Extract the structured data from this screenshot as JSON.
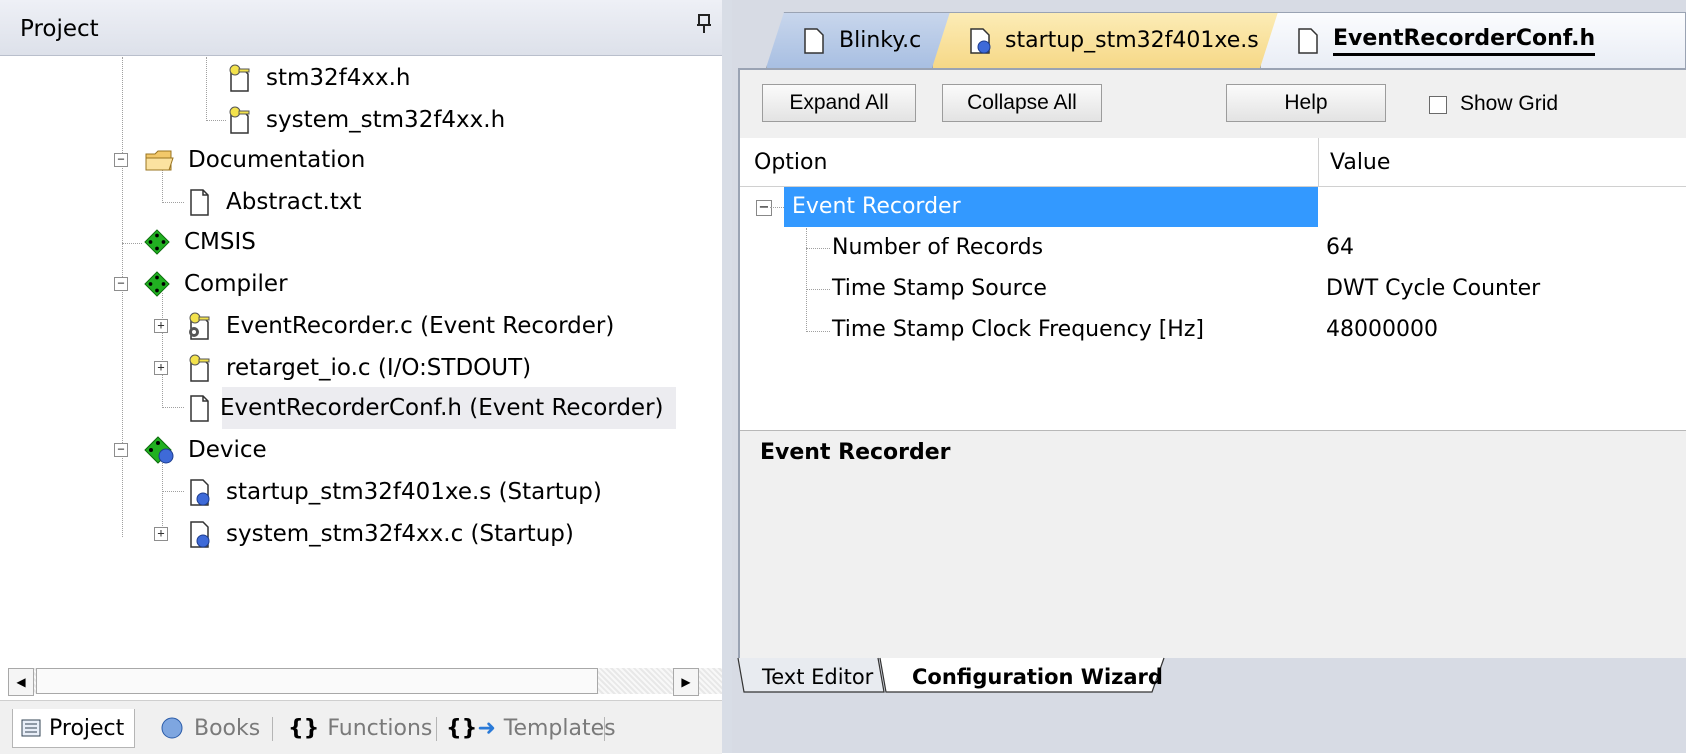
{
  "project_pane": {
    "title": "Project",
    "tree": [
      {
        "label": "stm32f4xx.h",
        "icon": "header-key-icon"
      },
      {
        "label": "system_stm32f4xx.h",
        "icon": "header-key-icon"
      },
      {
        "label": "Documentation",
        "icon": "folder-icon",
        "expanded": true
      },
      {
        "label": "Abstract.txt",
        "icon": "file-icon"
      },
      {
        "label": "CMSIS",
        "icon": "component-icon"
      },
      {
        "label": "Compiler",
        "icon": "component-icon",
        "expanded": true
      },
      {
        "label": "EventRecorder.c (Event Recorder)",
        "icon": "gear-key-icon",
        "expandable": true
      },
      {
        "label": "retarget_io.c (I/O:STDOUT)",
        "icon": "header-key-icon",
        "expandable": true
      },
      {
        "label": "EventRecorderConf.h (Event Recorder)",
        "icon": "file-icon",
        "selected": true
      },
      {
        "label": "Device",
        "icon": "component-blue-icon",
        "expanded": true
      },
      {
        "label": "startup_stm32f401xe.s (Startup)",
        "icon": "startup-file-icon"
      },
      {
        "label": "system_stm32f4xx.c (Startup)",
        "icon": "startup-file-icon",
        "expandable": true
      }
    ],
    "bottom_tabs": [
      {
        "label": "Project",
        "active": true
      },
      {
        "label": "Books"
      },
      {
        "label": "Functions"
      },
      {
        "label": "Templates"
      }
    ]
  },
  "editor": {
    "tabs": [
      {
        "label": "Blinky.c"
      },
      {
        "label": "startup_stm32f401xe.s"
      },
      {
        "label": "EventRecorderConf.h",
        "active": true
      }
    ],
    "toolbar": {
      "expand_all": "Expand All",
      "collapse_all": "Collapse All",
      "help": "Help",
      "show_grid": "Show Grid"
    },
    "columns": {
      "option": "Option",
      "value": "Value"
    },
    "options": [
      {
        "label": "Event Recorder",
        "value": "",
        "group": true
      },
      {
        "label": "Number of Records",
        "value": "64"
      },
      {
        "label": "Time Stamp Source",
        "value": "DWT Cycle Counter"
      },
      {
        "label": "Time Stamp Clock Frequency [Hz]",
        "value": "48000000"
      }
    ],
    "description_title": "Event Recorder",
    "sub_tabs": {
      "text_editor": "Text Editor",
      "config_wizard": "Configuration Wizard"
    }
  },
  "colors": {
    "selection": "#3399ff",
    "tab_active_underline": "#000000",
    "startup_tab": "#fbe3a0"
  }
}
